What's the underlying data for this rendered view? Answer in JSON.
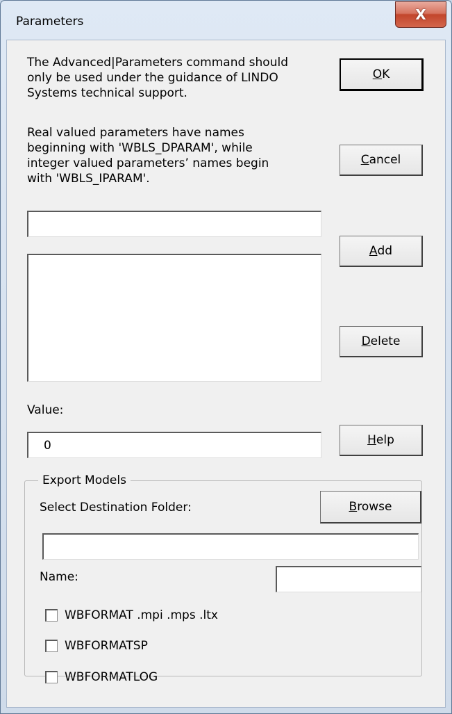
{
  "window": {
    "title": "Parameters",
    "close_label": "X"
  },
  "info": {
    "line1": "The Advanced|Parameters command should",
    "line2": "only be used under the guidance of LINDO",
    "line3": "Systems technical support.",
    "line4": "Real valued parameters have names",
    "line5": "beginning with 'WBLS_DPARAM', while",
    "line6": "integer valued parameters’ names begin",
    "line7": "with 'WBLS_IPARAM'."
  },
  "buttons": {
    "ok": {
      "mnemonic": "O",
      "rest": "K"
    },
    "cancel": {
      "mnemonic": "C",
      "rest": "ancel"
    },
    "add": {
      "mnemonic": "A",
      "rest": "dd"
    },
    "delete": {
      "mnemonic": "D",
      "rest": "elete"
    },
    "help": {
      "mnemonic": "H",
      "rest": "elp"
    },
    "browse": {
      "mnemonic": "B",
      "rest": "rowse"
    }
  },
  "parameter_input": {
    "value": ""
  },
  "parameter_list": {
    "items": []
  },
  "value": {
    "label": "Value:",
    "field_value": "0"
  },
  "export": {
    "legend": "Export Models",
    "folder_label": "Select Destination Folder:",
    "folder_value": "",
    "name_label": "Name:",
    "name_value": "",
    "formats": [
      {
        "label": "WBFORMAT .mpi .mps .ltx",
        "checked": false
      },
      {
        "label": "WBFORMATSP",
        "checked": false
      },
      {
        "label": "WBFORMATLOG",
        "checked": false
      }
    ]
  }
}
